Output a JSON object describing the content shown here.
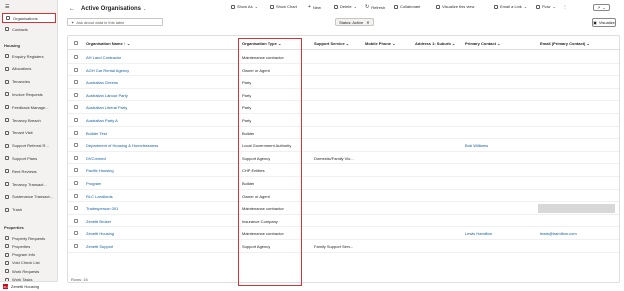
{
  "sidebar": {
    "top_items": [
      {
        "label": "Organisations",
        "icon": "building-icon",
        "active": true
      },
      {
        "label": "Contacts",
        "icon": "person-icon",
        "active": false
      }
    ],
    "housing_heading": "Housing",
    "housing_items": [
      {
        "label": "Enquiry Registers",
        "icon": "clipboard-icon"
      },
      {
        "label": "Allocations",
        "icon": "list-icon"
      },
      {
        "label": "Tenancies",
        "icon": "house-icon"
      },
      {
        "label": "Invoice Requests",
        "icon": "document-icon"
      },
      {
        "label": "Feedback Manage...",
        "icon": "chat-icon"
      },
      {
        "label": "Tenancy Breach",
        "icon": "warning-icon"
      },
      {
        "label": "Tenant Visit",
        "icon": "calendar-icon"
      },
      {
        "label": "Support Referral R...",
        "icon": "referral-icon"
      },
      {
        "label": "Support Plans",
        "icon": "plan-icon"
      },
      {
        "label": "Rent Reviews",
        "icon": "money-icon"
      },
      {
        "label": "Tenancy Transact...",
        "icon": "transaction-icon"
      },
      {
        "label": "Sustenance Transact...",
        "icon": "transaction-icon"
      },
      {
        "label": "Trash",
        "icon": "trash-icon"
      }
    ],
    "property_heading": "Properties",
    "property_items": [
      {
        "label": "Property Requests",
        "icon": "request-icon"
      },
      {
        "label": "Properties",
        "icon": "house-icon"
      },
      {
        "label": "Program Info",
        "icon": "info-icon"
      },
      {
        "label": "Void Check List",
        "icon": "checklist-icon"
      },
      {
        "label": "Work Requests",
        "icon": "wrench-icon"
      },
      {
        "label": "Work Tasks",
        "icon": "task-icon"
      },
      {
        "label": "Cyclical & Planne...",
        "icon": "cycle-icon"
      }
    ],
    "area": {
      "badge": "ZH",
      "label": "Zenetti Housing"
    }
  },
  "header": {
    "title": "Active Organisations",
    "commands": [
      {
        "label": "Show As",
        "icon": "table-icon"
      },
      {
        "label": "Show Chart",
        "icon": "chart-icon"
      },
      {
        "label": "New",
        "icon": "plus-icon"
      },
      {
        "label": "Delete",
        "icon": "trash-icon"
      },
      {
        "label": "Refresh",
        "icon": "refresh-icon"
      },
      {
        "label": "Collaborate",
        "icon": "people-icon"
      },
      {
        "label": "Visualize this view",
        "icon": "visualize-icon"
      },
      {
        "label": "Email a Link",
        "icon": "mail-icon"
      },
      {
        "label": "Flow",
        "icon": "flow-icon"
      }
    ],
    "overflow": "⋮",
    "share": "↗"
  },
  "filters": {
    "search_placeholder": "Ask about data in this table",
    "status_chip": "Status: Active",
    "visualize_label": "Visualize"
  },
  "columns": [
    "Organisation Name",
    "Organisation Type",
    "Support Service",
    "Mobile Phone",
    "Address 1: Suburb",
    "Primary Contact",
    "Email (Primary Contact)"
  ],
  "rows": [
    {
      "name": "AH Land Contractor",
      "type": "Maintenance contractor",
      "support": "",
      "mobile": "",
      "suburb": "",
      "contact": "",
      "email": ""
    },
    {
      "name": "AGH Car Rental Agency",
      "type": "Owner or Agent",
      "support": "",
      "mobile": "",
      "suburb": "",
      "contact": "",
      "email": ""
    },
    {
      "name": "Australian Greens",
      "type": "Party",
      "support": "",
      "mobile": "",
      "suburb": "",
      "contact": "",
      "email": ""
    },
    {
      "name": "Australian Labour Party",
      "type": "Party",
      "support": "",
      "mobile": "",
      "suburb": "",
      "contact": "",
      "email": ""
    },
    {
      "name": "Australian Liberal Party",
      "type": "Party",
      "support": "",
      "mobile": "",
      "suburb": "",
      "contact": "",
      "email": ""
    },
    {
      "name": "Australian Party A",
      "type": "Party",
      "support": "",
      "mobile": "",
      "suburb": "",
      "contact": "",
      "email": ""
    },
    {
      "name": "Builder Test",
      "type": "Builder",
      "support": "",
      "mobile": "",
      "suburb": "",
      "contact": "",
      "email": ""
    },
    {
      "name": "Department of Housing & Homelessness",
      "type": "Local Government Authority",
      "support": "",
      "mobile": "",
      "suburb": "",
      "contact": "Bob Williams",
      "email": ""
    },
    {
      "name": "DVConnect",
      "type": "Support Agency",
      "support": "Domestic/Family Vio...",
      "mobile": "",
      "suburb": "",
      "contact": "",
      "email": ""
    },
    {
      "name": "Pacific Housing",
      "type": "CHP Entities",
      "support": "",
      "mobile": "",
      "suburb": "",
      "contact": "",
      "email": ""
    },
    {
      "name": "Program",
      "type": "Builder",
      "support": "",
      "mobile": "",
      "suburb": "",
      "contact": "",
      "email": ""
    },
    {
      "name": "RLC Landlords",
      "type": "Owner or Agent",
      "support": "",
      "mobile": "",
      "suburb": "",
      "contact": "",
      "email": ""
    },
    {
      "name": "Tradesperson 001",
      "type": "Maintenance contractor",
      "support": "",
      "mobile": "",
      "suburb": "",
      "contact": "",
      "email": ""
    },
    {
      "name": "Zenetti Broker",
      "type": "Insurance Company",
      "support": "",
      "mobile": "",
      "suburb": "",
      "contact": "",
      "email": ""
    },
    {
      "name": "Zenetti Housing",
      "type": "Maintenance contractor",
      "support": "",
      "mobile": "",
      "suburb": "",
      "contact": "Lewis Hamilton",
      "email": "lewis@hamilton.com"
    },
    {
      "name": "Zenetti Support",
      "type": "Support Agency",
      "support": "Family Support Serv...",
      "mobile": "",
      "suburb": "",
      "contact": "",
      "email": ""
    }
  ],
  "footer": {
    "rows_label": "Rows: 16"
  },
  "colors": {
    "accent_red": "#d13438",
    "link": "#115ea3"
  }
}
